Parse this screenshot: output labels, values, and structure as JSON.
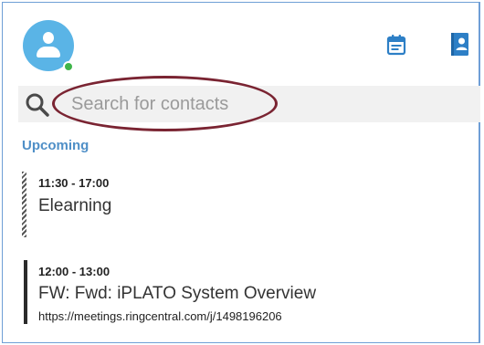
{
  "colors": {
    "accent": "#4f8fc7",
    "avatar": "#5ab4e6",
    "presence_online": "#3fb54a",
    "annotation_ring": "#7a2432"
  },
  "header": {
    "avatar_icon": "user-avatar-icon",
    "presence_status": "online",
    "icons": [
      "calendar-notes-icon",
      "contacts-book-icon"
    ]
  },
  "search": {
    "icon": "search-icon",
    "placeholder": "Search for contacts",
    "value": ""
  },
  "upcoming": {
    "label": "Upcoming",
    "events": [
      {
        "time": "11:30 - 17:00",
        "title": "Elearning",
        "link": "",
        "bar_style": "dashed"
      },
      {
        "time": "12:00 - 13:00",
        "title": "FW: Fwd: iPLATO System Overview",
        "link": "https://meetings.ringcentral.com/j/1498196206",
        "bar_style": "solid"
      }
    ]
  }
}
